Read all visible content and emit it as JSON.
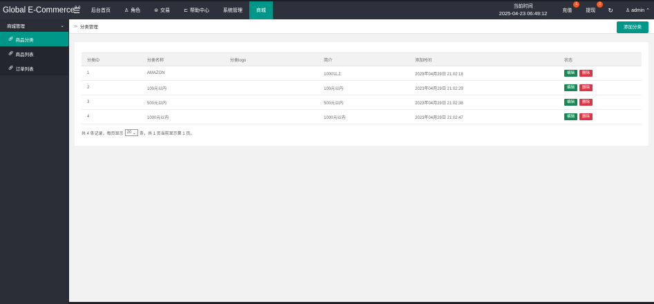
{
  "app": {
    "brand": "Global E-Commerce",
    "brand_version": "3.0"
  },
  "topbar": {
    "nav": [
      {
        "icon": "",
        "label": "后台首页"
      },
      {
        "icon": "♙",
        "label": "角色"
      },
      {
        "icon": "⊜",
        "label": "交易"
      },
      {
        "icon": "⊏",
        "label": "帮助中心"
      },
      {
        "icon": "",
        "label": "系统管理"
      },
      {
        "icon": "",
        "label": "商城"
      }
    ],
    "time_label": "当前时间",
    "time_value": "2025-04-23 06:49:12",
    "recharge_label": "充值",
    "recharge_badge": "1",
    "withdraw_label": "提现",
    "withdraw_badge": "0",
    "user_label": "admin",
    "colors": {
      "bar": "#2c313b",
      "active": "#009688",
      "badge": "#ff5722"
    }
  },
  "sidebar": {
    "group_label": "商城管理",
    "items": [
      {
        "label": "商品分类"
      },
      {
        "label": "商品列表"
      },
      {
        "label": "订单列表"
      }
    ]
  },
  "main": {
    "breadcrumb": "分类管理",
    "add_button": "添加分类",
    "table": {
      "headers": [
        "分类ID",
        "分类名称",
        "分类logo",
        "简介",
        "添加时间",
        "状态"
      ],
      "rows": [
        {
          "id": "1",
          "name": "AMAZON",
          "logo": "",
          "intro": "1000以上",
          "time": "2023年04月29日 21:02:18"
        },
        {
          "id": "2",
          "name": "100元以内",
          "logo": "",
          "intro": "100元以内",
          "time": "2023年04月29日 21:02:29"
        },
        {
          "id": "3",
          "name": "500元以内",
          "logo": "",
          "intro": "500元以内",
          "time": "2023年04月29日 21:02:38"
        },
        {
          "id": "4",
          "name": "1000元以内",
          "logo": "",
          "intro": "1000元以内",
          "time": "2023年04月29日 21:02:47"
        }
      ],
      "edit_label": "编辑",
      "delete_label": "删除"
    },
    "pager": {
      "prefix": "共 4 条记录，每页显示",
      "page_size": "20",
      "suffix": "条，共 1 页当前显示第 1 页。"
    }
  }
}
